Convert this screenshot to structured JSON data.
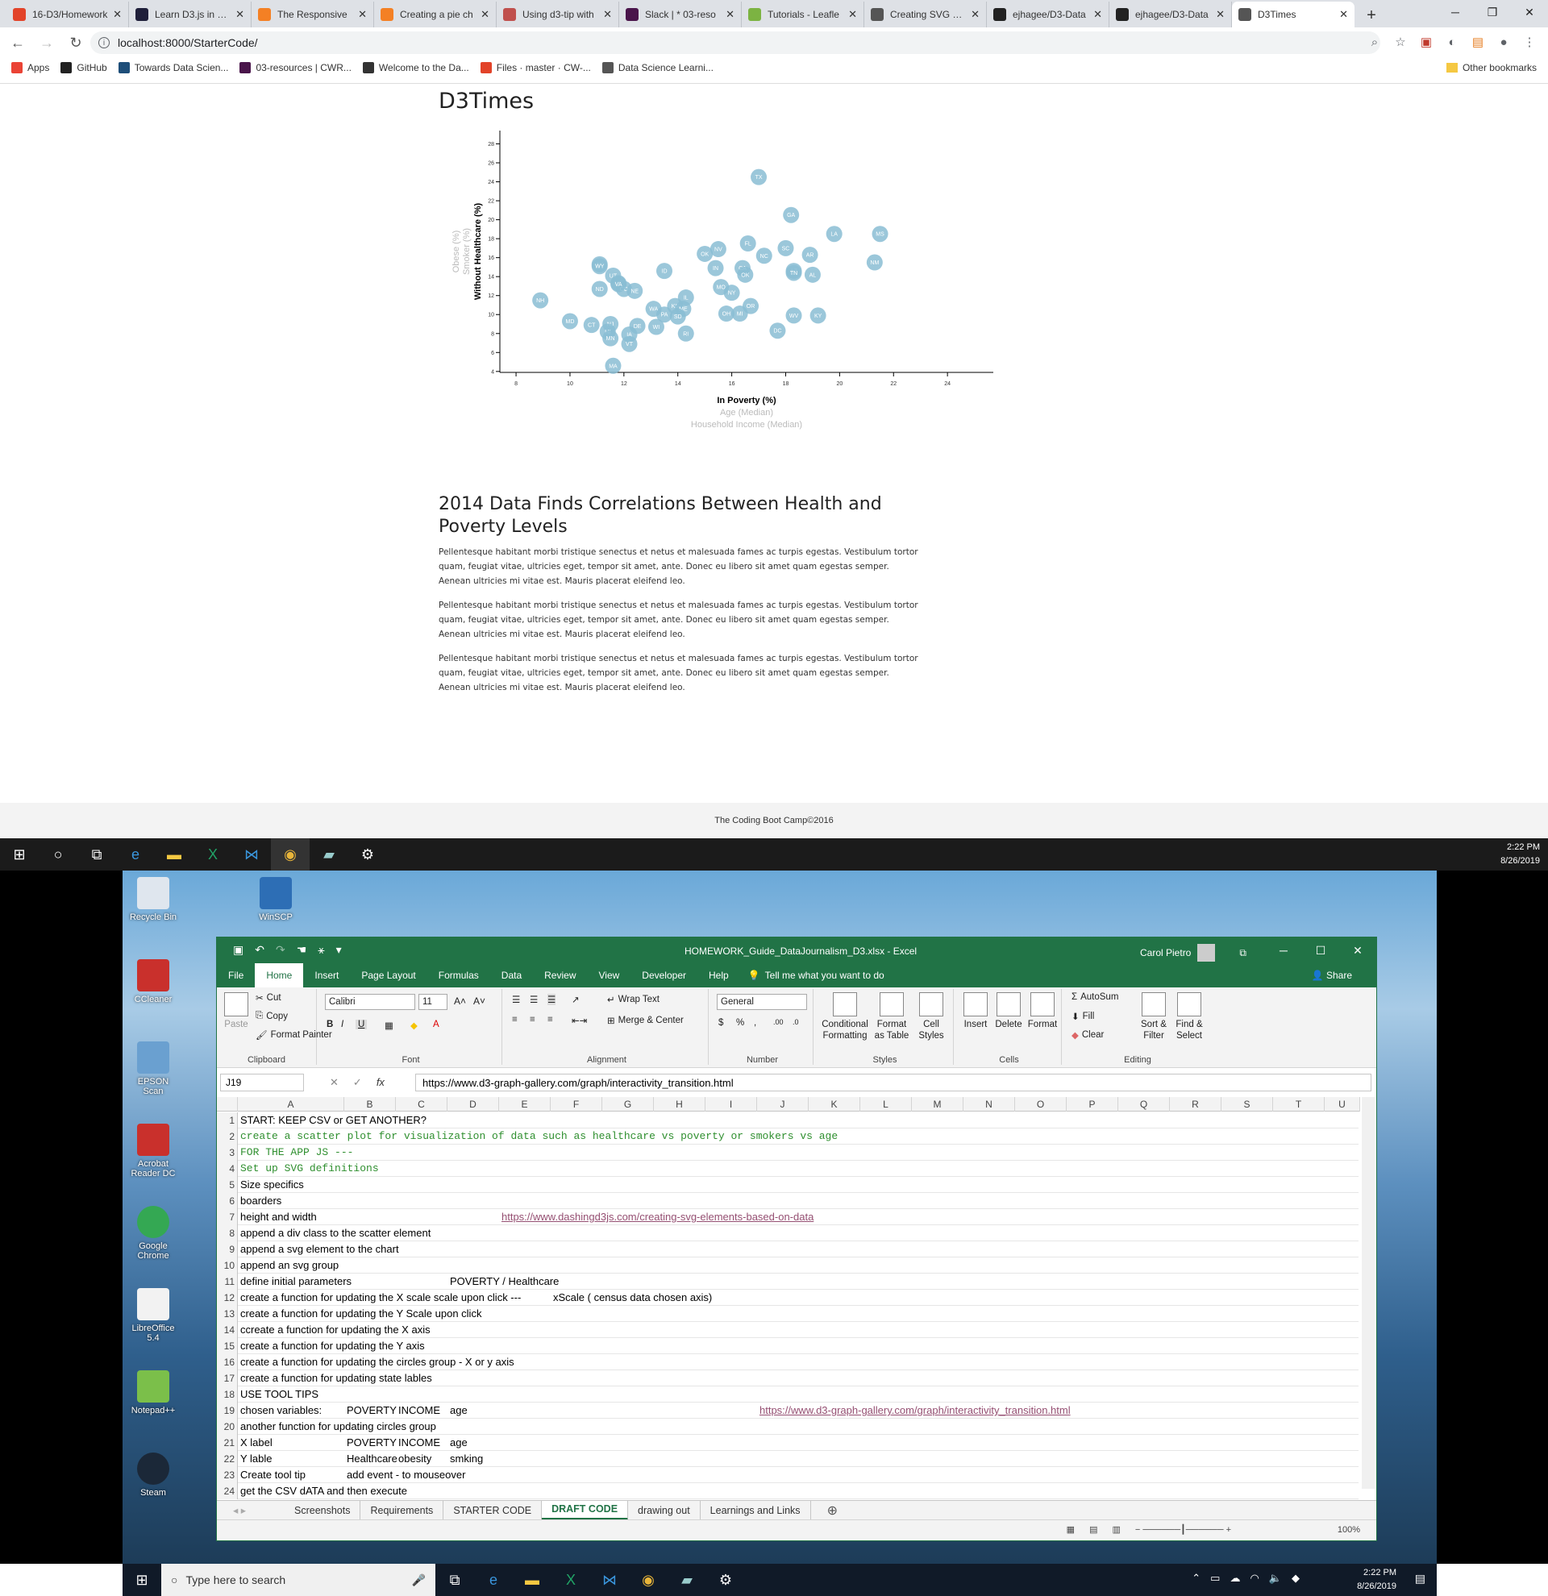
{
  "browser": {
    "tabs": [
      {
        "title": "16-D3/Homework",
        "fav_color": "#e24329"
      },
      {
        "title": "Learn D3.js in 5 m",
        "fav_color": "#1f1f3a"
      },
      {
        "title": "The Responsive",
        "fav_color": "#f48024"
      },
      {
        "title": "Creating a pie ch",
        "fav_color": "#f48024"
      },
      {
        "title": "Using d3-tip with",
        "fav_color": "#c0504d"
      },
      {
        "title": "Slack | * 03-reso",
        "fav_color": "#4a154b"
      },
      {
        "title": "Tutorials - Leafle",
        "fav_color": "#7cb342"
      },
      {
        "title": "Creating SVG Ele",
        "fav_color": "#555555"
      },
      {
        "title": "ejhagee/D3-Data",
        "fav_color": "#222222"
      },
      {
        "title": "ejhagee/D3-Data",
        "fav_color": "#222222"
      },
      {
        "title": "D3Times",
        "fav_color": "#555555",
        "active": true
      }
    ],
    "new_tab": "+",
    "url": "localhost:8000/StarterCode/",
    "bookmarks": [
      {
        "label": "Apps",
        "color": "#ea4335"
      },
      {
        "label": "GitHub",
        "color": "#222222"
      },
      {
        "label": "Towards Data Scien...",
        "color": "#1e4e79"
      },
      {
        "label": "03-resources | CWR...",
        "color": "#4a154b"
      },
      {
        "label": "Welcome to the Da...",
        "color": "#333333"
      },
      {
        "label": "Files · master · CW-...",
        "color": "#e24329"
      },
      {
        "label": "Data Science Learni...",
        "color": "#555555"
      }
    ],
    "other_bookmarks": "Other bookmarks"
  },
  "page": {
    "title": "D3Times",
    "article_title": "2014 Data Finds Correlations Between Health and Poverty Levels",
    "paragraphs": [
      "Pellentesque habitant morbi tristique senectus et netus et malesuada fames ac turpis egestas. Vestibulum tortor quam, feugiat vitae, ultricies eget, tempor sit amet, ante. Donec eu libero sit amet quam egestas semper. Aenean ultricies mi vitae est. Mauris placerat eleifend leo.",
      "Pellentesque habitant morbi tristique senectus et netus et malesuada fames ac turpis egestas. Vestibulum tortor quam, feugiat vitae, ultricies eget, tempor sit amet, ante. Donec eu libero sit amet quam egestas semper. Aenean ultricies mi vitae est. Mauris placerat eleifend leo.",
      "Pellentesque habitant morbi tristique senectus et netus et malesuada fames ac turpis egestas. Vestibulum tortor quam, feugiat vitae, ultricies eget, tempor sit amet, ante. Donec eu libero sit amet quam egestas semper. Aenean ultricies mi vitae est. Mauris placerat eleifend leo."
    ],
    "footer": "The Coding Boot Camp©2016"
  },
  "chart_data": {
    "type": "scatter",
    "xlabel": "In Poverty (%)",
    "x_alt_labels": [
      "Age (Median)",
      "Household Income (Median)"
    ],
    "ylabel": "Without Healthcare (%)",
    "y_alt_labels": [
      "Smoker (%)",
      "Obese (%)"
    ],
    "xlim": [
      7.4,
      25.7
    ],
    "ylim": [
      3.9,
      29.4
    ],
    "x_ticks": [
      8,
      10,
      12,
      14,
      16,
      18,
      20,
      22,
      24
    ],
    "y_ticks": [
      4,
      6,
      8,
      10,
      12,
      14,
      16,
      18,
      20,
      22,
      24,
      26,
      28
    ],
    "point_color": "#89bdd3",
    "points": [
      {
        "abbr": "TX",
        "x": 17.0,
        "y": 24.5
      },
      {
        "abbr": "GA",
        "x": 18.2,
        "y": 20.5
      },
      {
        "abbr": "LA",
        "x": 19.8,
        "y": 18.5
      },
      {
        "abbr": "MS",
        "x": 21.5,
        "y": 18.5
      },
      {
        "abbr": "FL",
        "x": 16.6,
        "y": 17.5
      },
      {
        "abbr": "SC",
        "x": 18.0,
        "y": 17.0
      },
      {
        "abbr": "AR",
        "x": 18.9,
        "y": 16.3
      },
      {
        "abbr": "NC",
        "x": 17.2,
        "y": 16.2
      },
      {
        "abbr": "NV",
        "x": 15.5,
        "y": 16.9
      },
      {
        "abbr": "OK",
        "x": 15.0,
        "y": 16.4
      },
      {
        "abbr": "NM",
        "x": 21.3,
        "y": 15.5
      },
      {
        "abbr": "AK",
        "x": 11.1,
        "y": 15.3
      },
      {
        "abbr": "WY",
        "x": 11.1,
        "y": 15.1
      },
      {
        "abbr": "IN",
        "x": 15.4,
        "y": 14.9
      },
      {
        "abbr": "CA",
        "x": 16.4,
        "y": 14.9
      },
      {
        "abbr": "ID",
        "x": 13.5,
        "y": 14.6
      },
      {
        "abbr": "AL",
        "x": 19.0,
        "y": 14.2
      },
      {
        "abbr": "AZ",
        "x": 18.3,
        "y": 14.6
      },
      {
        "abbr": "TN",
        "x": 18.3,
        "y": 14.4
      },
      {
        "abbr": "OK",
        "x": 16.5,
        "y": 14.2
      },
      {
        "abbr": "UT",
        "x": 11.6,
        "y": 14.1
      },
      {
        "abbr": "MT",
        "x": 11.8,
        "y": 13.3
      },
      {
        "abbr": "CO",
        "x": 12.0,
        "y": 12.7
      },
      {
        "abbr": "NE",
        "x": 12.4,
        "y": 12.5
      },
      {
        "abbr": "ND",
        "x": 11.1,
        "y": 12.7
      },
      {
        "abbr": "VA",
        "x": 11.8,
        "y": 13.2
      },
      {
        "abbr": "NY",
        "x": 16.0,
        "y": 12.3
      },
      {
        "abbr": "MO",
        "x": 15.6,
        "y": 12.9
      },
      {
        "abbr": "KY",
        "x": 19.2,
        "y": 9.9
      },
      {
        "abbr": "WV",
        "x": 18.3,
        "y": 9.9
      },
      {
        "abbr": "IL",
        "x": 14.3,
        "y": 11.8
      },
      {
        "abbr": "OR",
        "x": 16.7,
        "y": 10.9
      },
      {
        "abbr": "OH",
        "x": 15.8,
        "y": 10.1
      },
      {
        "abbr": "MI",
        "x": 16.3,
        "y": 10.1
      },
      {
        "abbr": "DC",
        "x": 17.7,
        "y": 8.3
      },
      {
        "abbr": "NH",
        "x": 8.9,
        "y": 11.5
      },
      {
        "abbr": "KS",
        "x": 13.9,
        "y": 10.9
      },
      {
        "abbr": "ME",
        "x": 14.2,
        "y": 10.6
      },
      {
        "abbr": "WA",
        "x": 13.1,
        "y": 10.6
      },
      {
        "abbr": "PA",
        "x": 13.5,
        "y": 10.0
      },
      {
        "abbr": "SD",
        "x": 14.0,
        "y": 9.8
      },
      {
        "abbr": "MD",
        "x": 10.0,
        "y": 9.3
      },
      {
        "abbr": "CT",
        "x": 10.8,
        "y": 8.9
      },
      {
        "abbr": "NJ",
        "x": 11.5,
        "y": 9.0
      },
      {
        "abbr": "DE",
        "x": 12.5,
        "y": 8.8
      },
      {
        "abbr": "WI",
        "x": 13.2,
        "y": 8.7
      },
      {
        "abbr": "HI",
        "x": 11.4,
        "y": 8.2
      },
      {
        "abbr": "IA",
        "x": 12.2,
        "y": 7.9
      },
      {
        "abbr": "MN",
        "x": 11.5,
        "y": 7.5
      },
      {
        "abbr": "RI",
        "x": 14.3,
        "y": 8.0
      },
      {
        "abbr": "VT",
        "x": 12.2,
        "y": 6.9
      },
      {
        "abbr": "MA",
        "x": 11.6,
        "y": 4.6
      }
    ]
  },
  "taskbar_top": {
    "time": "2:22 PM",
    "date": "8/26/2019"
  },
  "desktop_icons": [
    {
      "label": "Recycle Bin",
      "color": "#dfe6ee"
    },
    {
      "label": "WinSCP",
      "color": "#2d6eb5"
    },
    {
      "label": "CCleaner",
      "color": "#c9302c"
    },
    {
      "label": "EPSON Scan",
      "color": "#6aa0d0"
    },
    {
      "label": "Acrobat Reader DC",
      "color": "#c9302c"
    },
    {
      "label": "Google Chrome",
      "color": "#34a853"
    },
    {
      "label": "LibreOffice 5.4",
      "color": "#f2f2f2"
    },
    {
      "label": "Notepad++",
      "color": "#7bbf4a"
    },
    {
      "label": "Steam",
      "color": "#1b2838"
    }
  ],
  "excel": {
    "filename": "HOMEWORK_Guide_DataJournalism_D3.xlsx - Excel",
    "user": "Carol Pietro",
    "tabs": [
      "File",
      "Home",
      "Insert",
      "Page Layout",
      "Formulas",
      "Data",
      "Review",
      "View",
      "Developer",
      "Help"
    ],
    "active_tab": "Home",
    "tell_me": "Tell me what you want to do",
    "share": "Share",
    "ribbon": {
      "clipboard": {
        "paste": "Paste",
        "cut": "Cut",
        "copy": "Copy",
        "format_painter": "Format Painter",
        "label": "Clipboard"
      },
      "font": {
        "name": "Calibri",
        "size": "11",
        "label": "Font"
      },
      "alignment": {
        "wrap": "Wrap Text",
        "merge": "Merge & Center",
        "label": "Alignment"
      },
      "number": {
        "format": "General",
        "label": "Number"
      },
      "styles": {
        "cond": "Conditional Formatting",
        "table": "Format as Table",
        "cell": "Cell Styles",
        "label": "Styles"
      },
      "cells": {
        "insert": "Insert",
        "delete": "Delete",
        "format": "Format",
        "label": "Cells"
      },
      "editing": {
        "autosum": "AutoSum",
        "fill": "Fill",
        "clear": "Clear",
        "sort": "Sort & Filter",
        "find": "Find & Select",
        "label": "Editing"
      }
    },
    "name_box": "J19",
    "formula": "https://www.d3-graph-gallery.com/graph/interactivity_transition.html",
    "columns": [
      "A",
      "B",
      "C",
      "D",
      "E",
      "F",
      "G",
      "H",
      "I",
      "J",
      "K",
      "L",
      "M",
      "N",
      "O",
      "P",
      "Q",
      "R",
      "S",
      "T",
      "U"
    ],
    "rows": [
      {
        "n": "1",
        "cells": [
          {
            "col": "A",
            "text": "START:  KEEP CSV  or GET ANOTHER?"
          }
        ]
      },
      {
        "n": "2",
        "cells": [
          {
            "col": "A",
            "text": "create a scatter plot for visualization of data such as healthcare vs poverty or smokers vs age",
            "style": "green"
          }
        ]
      },
      {
        "n": "3",
        "cells": [
          {
            "col": "A",
            "text": "FOR THE APP JS ---",
            "style": "green"
          }
        ]
      },
      {
        "n": "4",
        "cells": [
          {
            "col": "A",
            "text": "Set up SVG definitions",
            "style": "green"
          }
        ]
      },
      {
        "n": "5",
        "cells": [
          {
            "col": "A",
            "text": "Size specifics"
          }
        ]
      },
      {
        "n": "6",
        "cells": [
          {
            "col": "A",
            "text": "boarders"
          }
        ]
      },
      {
        "n": "7",
        "cells": [
          {
            "col": "A",
            "text": "height and width"
          },
          {
            "col": "E",
            "text": "https://www.dashingd3js.com/creating-svg-elements-based-on-data",
            "style": "link"
          }
        ]
      },
      {
        "n": "8",
        "cells": [
          {
            "col": "A",
            "text": "append a div class to the scatter element"
          }
        ]
      },
      {
        "n": "9",
        "cells": [
          {
            "col": "A",
            "text": "append a svg element to the chart"
          }
        ]
      },
      {
        "n": "10",
        "cells": [
          {
            "col": "A",
            "text": "append an svg group"
          }
        ]
      },
      {
        "n": "11",
        "cells": [
          {
            "col": "A",
            "text": "define initial parameters"
          },
          {
            "col": "D",
            "text": "POVERTY / Healthcare"
          }
        ]
      },
      {
        "n": "12",
        "cells": [
          {
            "col": "A",
            "text": "create a function for updating the X scale scale upon click ---"
          },
          {
            "col": "F",
            "text": "xScale ( census data chosen axis)"
          }
        ]
      },
      {
        "n": "13",
        "cells": [
          {
            "col": "A",
            "text": "create a function for updating the Y Scale upon click"
          }
        ]
      },
      {
        "n": "14",
        "cells": [
          {
            "col": "A",
            "text": "ccreate a function for updating the X axis"
          }
        ]
      },
      {
        "n": "15",
        "cells": [
          {
            "col": "A",
            "text": "create a function for updating the Y axis"
          }
        ]
      },
      {
        "n": "16",
        "cells": [
          {
            "col": "A",
            "text": "create a function for updating the circles group - X or y axis"
          }
        ]
      },
      {
        "n": "17",
        "cells": [
          {
            "col": "A",
            "text": "create a function for updating state lables"
          }
        ]
      },
      {
        "n": "18",
        "cells": [
          {
            "col": "A",
            "text": "USE TOOL TIPS"
          }
        ]
      },
      {
        "n": "19",
        "cells": [
          {
            "col": "A",
            "text": "chosen variables:"
          },
          {
            "col": "B",
            "text": "POVERTY"
          },
          {
            "col": "C",
            "text": "INCOME"
          },
          {
            "col": "D",
            "text": "age"
          },
          {
            "col": "J",
            "text": "https://www.d3-graph-gallery.com/graph/interactivity_transition.html",
            "style": "link"
          }
        ]
      },
      {
        "n": "20",
        "cells": [
          {
            "col": "A",
            "text": "another function for updating circles group"
          }
        ]
      },
      {
        "n": "21",
        "cells": [
          {
            "col": "A",
            "text": "X label"
          },
          {
            "col": "B",
            "text": "POVERTY"
          },
          {
            "col": "C",
            "text": "INCOME"
          },
          {
            "col": "D",
            "text": "age"
          }
        ]
      },
      {
        "n": "22",
        "cells": [
          {
            "col": "A",
            "text": "Y lable"
          },
          {
            "col": "B",
            "text": "Healthcare"
          },
          {
            "col": "C",
            "text": "obesity"
          },
          {
            "col": "D",
            "text": "smking"
          }
        ]
      },
      {
        "n": "23",
        "cells": [
          {
            "col": "A",
            "text": "Create tool tip"
          },
          {
            "col": "B",
            "text": "add event - to mouseover"
          }
        ]
      },
      {
        "n": "24",
        "cells": [
          {
            "col": "A",
            "text": "get the CSV dATA and then execute"
          }
        ]
      }
    ],
    "sheets": [
      "Screenshots",
      "Requirements",
      "STARTER CODE",
      "DRAFT CODE",
      "drawing out",
      "Learnings and Links"
    ],
    "active_sheet": "DRAFT CODE",
    "zoom": "100%"
  },
  "taskbar_bottom": {
    "search_placeholder": "Type here to search",
    "time": "2:22 PM",
    "date": "8/26/2019"
  }
}
